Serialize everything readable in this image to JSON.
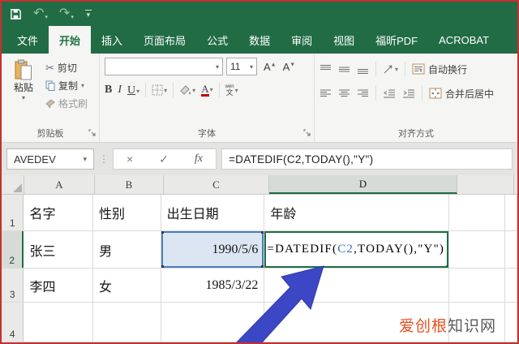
{
  "qat": {
    "undo_glyph": "↶",
    "redo_glyph": "↷",
    "caret_glyph": "▾"
  },
  "tabs": [
    {
      "label": "文件"
    },
    {
      "label": "开始"
    },
    {
      "label": "插入"
    },
    {
      "label": "页面布局"
    },
    {
      "label": "公式"
    },
    {
      "label": "数据"
    },
    {
      "label": "审阅"
    },
    {
      "label": "视图"
    },
    {
      "label": "福昕PDF"
    },
    {
      "label": "ACROBAT"
    }
  ],
  "ribbon": {
    "clipboard": {
      "paste": "粘贴",
      "cut": "剪切",
      "copy": "复制",
      "format_painter": "格式刷",
      "group_label": "剪贴板"
    },
    "font": {
      "font_size": "11",
      "bold": "B",
      "italic": "I",
      "underline": "U",
      "grow": "A",
      "shrink": "A",
      "phonetic_top": "wén",
      "phonetic_bottom": "文",
      "color_a": "A",
      "group_label": "字体"
    },
    "alignment": {
      "wrap_text": "自动换行",
      "merge_center": "合并后居中",
      "group_label": "对齐方式"
    }
  },
  "formula_bar": {
    "name_box": "AVEDEV",
    "cancel_glyph": "×",
    "enter_glyph": "✓",
    "fx_label": "fx",
    "formula": "=DATEDIF(C2,TODAY(),\"Y\")"
  },
  "sheet": {
    "col_headers": [
      "A",
      "B",
      "C",
      "D"
    ],
    "row_headers": [
      "1",
      "2",
      "3",
      "4"
    ],
    "r1": {
      "a": "名字",
      "b": "性别",
      "c": "出生日期",
      "d": "年龄"
    },
    "r2": {
      "a": "张三",
      "b": "男",
      "c": "1990/5/6",
      "d_pre": "=DATEDIF(",
      "d_ref": "C2",
      "d_post": ",TODAY(),\"Y\")"
    },
    "r3": {
      "a": "李四",
      "b": "女",
      "c": "1985/3/22"
    }
  },
  "watermark": {
    "brand": "爱创根",
    "suffix": "知识网"
  },
  "colors": {
    "excel_green": "#216c45",
    "selection_green": "#1e6e44",
    "reference_blue": "#3f6dbf",
    "reference_fill": "#dce6f2",
    "arrow_blue": "#3c47c5",
    "watermark_orange": "#e8501e"
  }
}
